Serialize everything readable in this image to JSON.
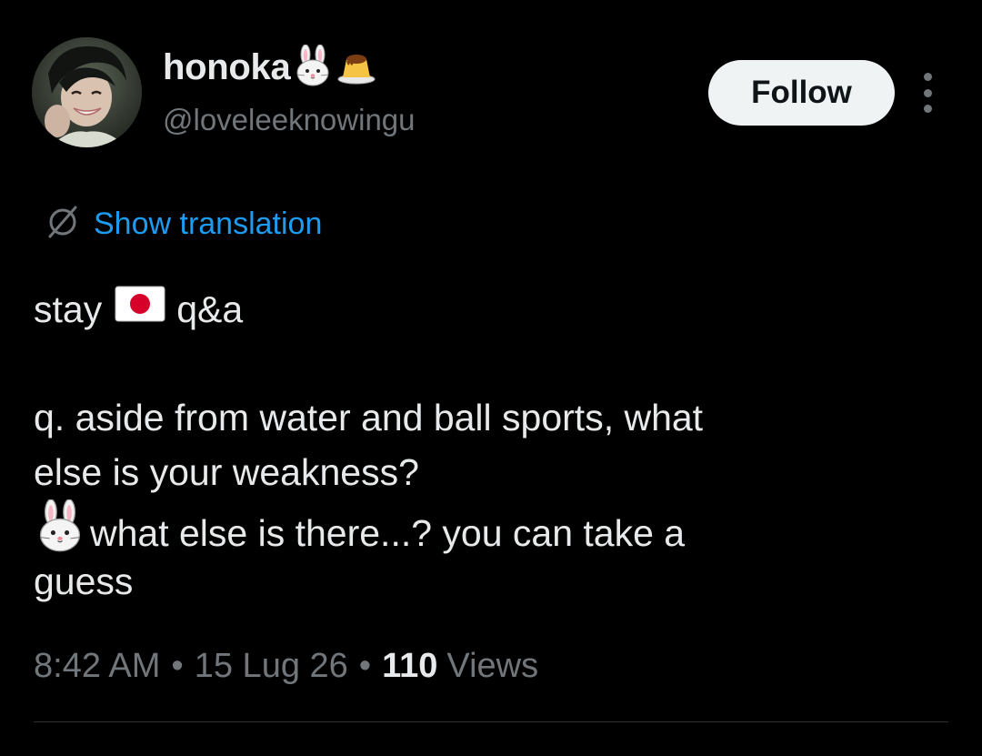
{
  "user": {
    "display_name": "honoka",
    "name_emojis": [
      "rabbit-face-icon",
      "custard-pudding-icon"
    ],
    "handle": "@loveleeknowingu"
  },
  "actions": {
    "follow_label": "Follow",
    "more_icon": "more-vertical-icon"
  },
  "translation": {
    "icon": "globe-slash-icon",
    "label": "Show translation"
  },
  "tweet": {
    "line1_before": "stay",
    "line1_flag": "japan-flag-icon",
    "line1_after": "q&a",
    "question_line1": "q. aside from water and ball sports, what",
    "question_line2": "else is your weakness?",
    "answer_emoji": "rabbit-face-icon",
    "answer_line1": "what else is there...? you can take a",
    "answer_line2": "guess"
  },
  "meta": {
    "time": "8:42 AM",
    "date": "15 Lug 26",
    "views_count": "110",
    "views_label": "Views",
    "separator": "•"
  },
  "colors": {
    "background": "#000000",
    "primary_text": "#e7e9ea",
    "secondary_text": "#71767b",
    "link": "#1d9bf0",
    "follow_bg": "#eff3f4",
    "divider": "#2f3336"
  }
}
